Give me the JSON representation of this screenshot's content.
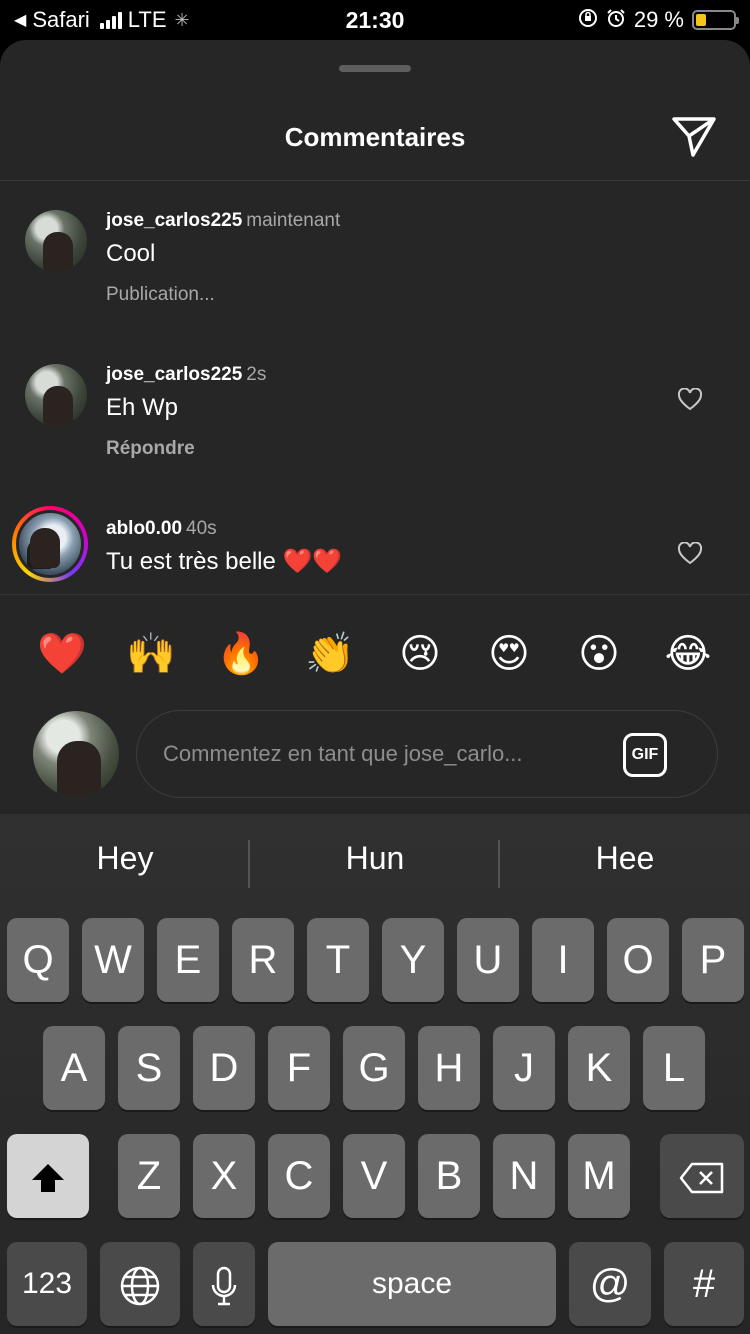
{
  "status_bar": {
    "back_app": "Safari",
    "network": "LTE",
    "time": "21:30",
    "battery": "29 %",
    "battery_level": 0.29
  },
  "sheet": {
    "title": "Commentaires"
  },
  "comments": [
    {
      "user": "jose_carlos225",
      "time": "maintenant",
      "text": "Cool",
      "action": "Publication..."
    },
    {
      "user": "jose_carlos225",
      "time": "2s",
      "text": "Eh Wp",
      "action": "Répondre"
    },
    {
      "user": "ablo0.00",
      "time": "40s",
      "text": "Tu est très belle",
      "text_hearts": "❤️❤️"
    }
  ],
  "emoji_bar": [
    "❤️",
    "🙌",
    "🔥",
    "👏",
    "😢",
    "😍",
    "😮",
    "😂"
  ],
  "comment_input": {
    "placeholder": "Commentez en tant que jose_carlo...",
    "gif_label": "GIF"
  },
  "keyboard": {
    "suggestions": [
      "Hey",
      "Hun",
      "Hee"
    ],
    "row1": [
      "Q",
      "W",
      "E",
      "R",
      "T",
      "Y",
      "U",
      "I",
      "O",
      "P"
    ],
    "row2": [
      "A",
      "S",
      "D",
      "F",
      "G",
      "H",
      "J",
      "K",
      "L"
    ],
    "row3": [
      "Z",
      "X",
      "C",
      "V",
      "B",
      "N",
      "M"
    ],
    "numbers_key": "123",
    "space_key": "space",
    "at_key": "@",
    "hash_key": "#"
  }
}
